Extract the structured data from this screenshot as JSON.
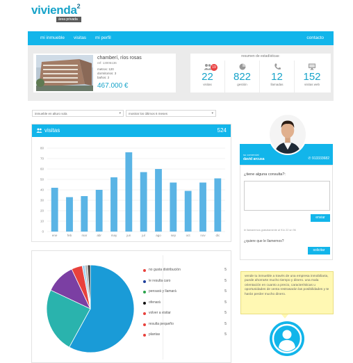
{
  "brand": {
    "name": "vivienda",
    "superscript": "2",
    "subtitle": "área privada"
  },
  "nav": {
    "items": [
      "mi inmueble",
      "visitas",
      "mi perfil"
    ],
    "contact": "contacto"
  },
  "property": {
    "name": "chamberí, ríos rosas",
    "ref": "ref: 13005136",
    "details": [
      "metros: 120",
      "dormitorios: 3",
      "baños: 2"
    ],
    "price": "467.000 €"
  },
  "stats": {
    "title": "resumen de estadísticas:",
    "items": [
      {
        "icon": "users-icon",
        "value": "22",
        "label": "visitas",
        "badge": "19"
      },
      {
        "icon": "pie-chart-icon",
        "value": "822",
        "label": "gestión"
      },
      {
        "icon": "phone-icon",
        "value": "12",
        "label": "llamadas"
      },
      {
        "icon": "monitor-icon",
        "value": "152",
        "label": "visitas web"
      }
    ]
  },
  "filters": {
    "property_select": "inmueble en alturo sola",
    "range_select": "mostrar los últimos 6 meses"
  },
  "visits": {
    "title": "visitas",
    "total": "524"
  },
  "chart_data": [
    {
      "type": "bar",
      "categories": [
        "ene",
        "feb",
        "mar",
        "abr",
        "may",
        "jun",
        "jul",
        "ago",
        "sep",
        "oct",
        "nov",
        "dic"
      ],
      "values": [
        42,
        33,
        34,
        40,
        52,
        76,
        57,
        60,
        47,
        39,
        47,
        51
      ],
      "ylim": [
        0,
        80
      ],
      "yticks": [
        0,
        10,
        20,
        30,
        40,
        50,
        60,
        70,
        80
      ],
      "grid": true,
      "color": "#5ab4e5"
    },
    {
      "type": "pie",
      "values": [
        58,
        24,
        11,
        4,
        1,
        1,
        1
      ],
      "colors": [
        "#1a9bd7",
        "#2ab3ad",
        "#7b3fa3",
        "#e8413c",
        "#9ed1f0",
        "#b8b8b8",
        "#333333"
      ]
    }
  ],
  "legend": [
    {
      "label": "no gusta distribución",
      "count": "5",
      "color": "#e8413c"
    },
    {
      "label": "le resulta caro",
      "count": "5",
      "color": "#1f3f9c"
    },
    {
      "label": "pensará y llamará",
      "count": "5",
      "color": "#2aa34a"
    },
    {
      "label": "ofenará",
      "count": "5",
      "color": "#111111"
    },
    {
      "label": "volver a visitar",
      "count": "5",
      "color": "#e8413c"
    },
    {
      "label": "resulta pequeño",
      "count": "5",
      "color": "#e8413c"
    },
    {
      "label": "plantas",
      "count": "5",
      "color": "#e8413c"
    }
  ],
  "agent": {
    "label": "su comercial",
    "name": "david arcusa",
    "phone": "913333682",
    "question": "¿tiene alguna consulta?:",
    "send_label": "enviar",
    "fine_print": "le llamaremos gratuitamente al 91x 22 sn 96",
    "call_question": "¿quiere que le llamemos?",
    "call_label": "solicitar"
  },
  "tip": "vende tu inmueble a través de una empresa inmobiliaria, puede ahorrarte mucho tiempo y dinero. una mala orientación en cuanto a precio, características u oportunidades de venta restrasarán las posibilidades y te harán perder mucho dinero.",
  "colors": {
    "accent": "#12b5ea",
    "brand": "#17a3c9",
    "tip_bg": "#fff8b3"
  }
}
